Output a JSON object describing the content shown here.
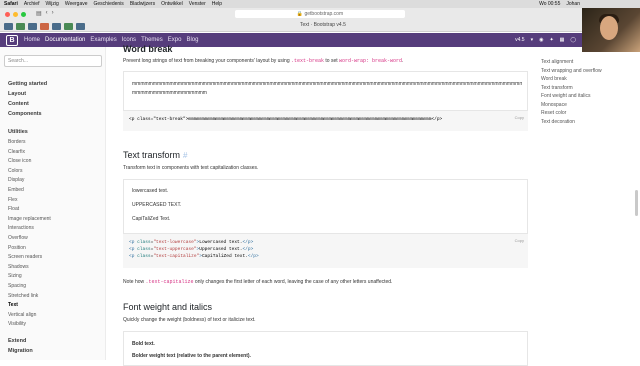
{
  "menubar": {
    "items": [
      "Safari",
      "Archief",
      "Wijzig",
      "Weergave",
      "Geschiedenis",
      "Bladwijzers",
      "Ontwikkel",
      "Venster",
      "Help"
    ],
    "status": [
      "Wo 00:55",
      "Johan"
    ]
  },
  "browser": {
    "url": "getbootstrap.com",
    "tab_title": "Text · Bootstrap v4.5"
  },
  "navbar": {
    "brand": "B",
    "links": [
      "Home",
      "Documentation",
      "Examples",
      "Icons",
      "Themes",
      "Expo",
      "Blog"
    ],
    "active": "Documentation",
    "version": "v4.5"
  },
  "sidebar": {
    "search_placeholder": "Search...",
    "top_links": [
      "Getting started",
      "Layout",
      "Content",
      "Components"
    ],
    "utilities_title": "Utilities",
    "utilities": [
      "Borders",
      "Clearfix",
      "Close icon",
      "Colors",
      "Display",
      "Embed",
      "Flex",
      "Float",
      "Image replacement",
      "Interactions",
      "Overflow",
      "Position",
      "Screen readers",
      "Shadows",
      "Sizing",
      "Spacing",
      "Stretched link",
      "Text",
      "Vertical align",
      "Visibility"
    ],
    "current": "Text",
    "bottom_links": [
      "Extend",
      "Migration"
    ]
  },
  "toc": [
    "Text alignment",
    "Text wrapping and overflow",
    "Word break",
    "Text transform",
    "Font weight and italics",
    "Monospace",
    "Reset color",
    "Text decoration"
  ],
  "word_break": {
    "title": "Word break",
    "desc_before": "Prevent long strings of text from breaking your components' layout by using",
    "desc_code1": ".text-break",
    "desc_mid": "to set",
    "desc_code2": "word-wrap: break-word",
    "example_line1": "mmmmmmmmmmmmmmmmmmmmmmmmmmmmmmmmmmmmmmmmmmmmmmmmmmmmmmmmmmmmmmmmmmmmmmmmmmmmmmmmmmmmmmmmmmmmmmmmmm",
    "example_line2": "mmmmmmmmmmmmmmmmmm",
    "code": "<p class=\"text-break\">mmmmmmmmmmmmmmmmmmmmmmmmmmmmmmmmmmmmmmmmmmmmmmmmmmmmmmmmmmmmmmmmmmmmmmmmmmmmmmmmmmmmmmmmmm</p>",
    "copy": "Copy"
  },
  "text_transform": {
    "title": "Text transform",
    "desc": "Transform text in components with text capitalization classes.",
    "examples": [
      "lowercased text.",
      "UPPERCASED TEXT.",
      "CapiTaliZed Text."
    ],
    "code_lines": [
      {
        "cls": "text-lowercase",
        "text": "Lowercased text."
      },
      {
        "cls": "text-uppercase",
        "text": "Uppercased text."
      },
      {
        "cls": "text-capitalize",
        "text": "CapiTaliZed text."
      }
    ],
    "copy": "Copy",
    "note_before": "Note how",
    "note_code": ".text-capitalize",
    "note_after": "only changes the first letter of each word, leaving the case of any other letters unaffected."
  },
  "font_weight": {
    "title": "Font weight and italics",
    "desc": "Quickly change the weight (boldness) of text or italicize text.",
    "examples": [
      "Bold text.",
      "Bolder weight text (relative to the parent element)."
    ]
  },
  "colors": {
    "navbar": "#563d7c",
    "code": "#d63384",
    "link": "#563d7c"
  }
}
